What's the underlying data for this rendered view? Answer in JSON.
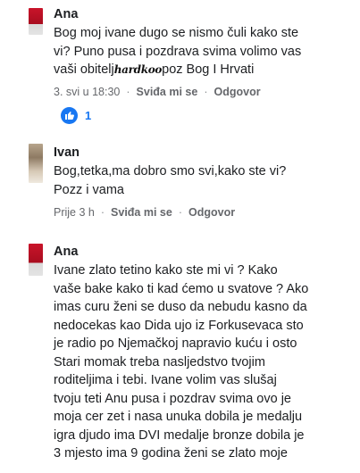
{
  "comments": [
    {
      "author": "Ana",
      "lines": [
        "Bog moj ivane dugo se nismo čuli  kako ste",
        "vi?  Puno pusa i pozdrava svima volimo vas",
        "vaši obitelj"
      ],
      "last_line_sticker": "hardkoo",
      "last_line_tail": "poz Bog I Hrvati",
      "time": "3. svi u 18:30",
      "like_label": "Sviđa mi se",
      "reply_label": "Odgovor",
      "reaction": {
        "icon": "thumbs-up-icon",
        "count": "1",
        "color": "#1877f2"
      }
    },
    {
      "author": "Ivan",
      "lines": [
        "Bog,tetka,ma dobro smo svi,kako ste vi?",
        "Pozz i vama"
      ],
      "time": "Prije 3 h",
      "like_label": "Sviđa mi se",
      "reply_label": "Odgovor"
    },
    {
      "author": "Ana",
      "lines": [
        "Ivane zlato tetino kako ste mi vi ? Kako",
        "vaše  bake kako ti kad ćemo u svatove ? Ako",
        "imas curu ženi se duso da nebudu kasno da",
        "nedocekas kao Dida ujo iz Forkusevaca sto",
        "je radio po Njemačkoj napravio kuću i osto",
        "Stari momak treba nasljedstvo tvojim",
        "roditeljima i tebi. Ivane volim vas slušaj",
        "tvoju teti Anu pusa i pozdrav svima ovo je",
        "moja cer zet i nasa unuka dobila je medalju",
        "igra djudo ima DVI medalje  bronze dobila je",
        "3 mjesto ima 9 godina ženi se zlato moje"
      ]
    }
  ]
}
